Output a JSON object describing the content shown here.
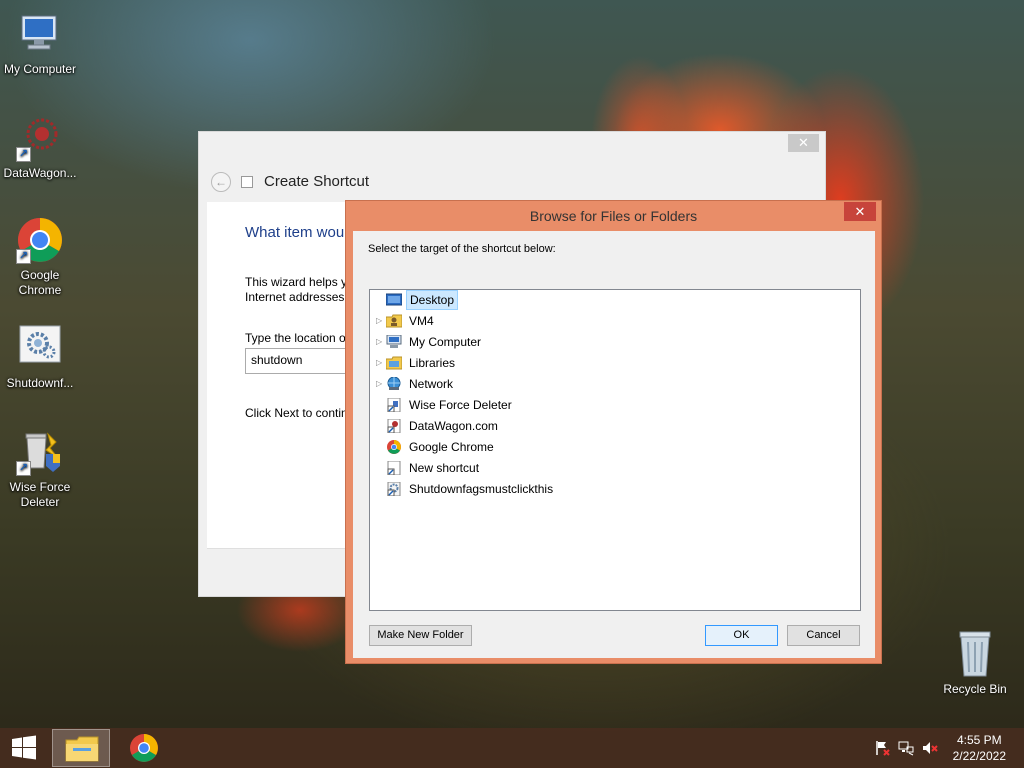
{
  "desktop": {
    "icons": [
      {
        "label": "My Computer"
      },
      {
        "label": "DataWagon..."
      },
      {
        "label": "Google Chrome"
      },
      {
        "label": "Shutdownf..."
      },
      {
        "label": "Wise Force Deleter"
      }
    ],
    "recycle_bin": {
      "label": "Recycle Bin"
    }
  },
  "wizard": {
    "title": "Create Shortcut",
    "heading": "What item wou",
    "description_line1": "This wizard helps y",
    "description_line2": "Internet addresses.",
    "location_label": "Type the location o",
    "location_value": "shutdown",
    "next_text": "Click Next to contin",
    "close_glyph": "✕"
  },
  "browse": {
    "title": "Browse for Files or Folders",
    "instruction": "Select the target of the shortcut below:",
    "tree": [
      {
        "label": "Desktop",
        "icon": "desktop-icon",
        "expandable": false,
        "selected": true
      },
      {
        "label": "VM4",
        "icon": "user-folder-icon",
        "expandable": true
      },
      {
        "label": "My Computer",
        "icon": "computer-icon",
        "expandable": true
      },
      {
        "label": "Libraries",
        "icon": "libraries-icon",
        "expandable": true
      },
      {
        "label": "Network",
        "icon": "network-icon",
        "expandable": true
      },
      {
        "label": "Wise Force Deleter",
        "icon": "shortcut-icon",
        "expandable": false
      },
      {
        "label": "DataWagon.com",
        "icon": "shortcut-icon",
        "expandable": false
      },
      {
        "label": "Google Chrome",
        "icon": "chrome-icon",
        "expandable": false
      },
      {
        "label": "New shortcut",
        "icon": "shortcut-icon",
        "expandable": false
      },
      {
        "label": "Shutdownfagsmustclickthis",
        "icon": "shortcut-icon",
        "expandable": false
      }
    ],
    "buttons": {
      "new_folder": "Make New Folder",
      "ok": "OK",
      "cancel": "Cancel"
    },
    "close_glyph": "✕"
  },
  "taskbar": {
    "time": "4:55 PM",
    "date": "2/22/2022"
  },
  "colors": {
    "dialog_accent": "#e98d68",
    "close_red": "#c7443b",
    "selection": "#cce8ff",
    "heading_blue": "#1e3f8a"
  }
}
